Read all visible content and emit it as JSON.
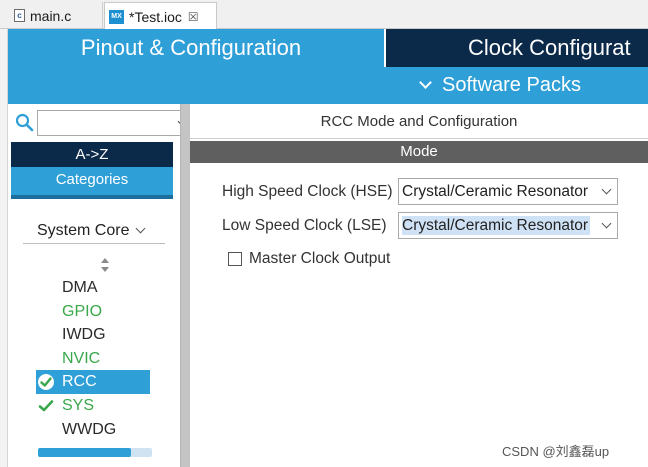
{
  "tabs": [
    {
      "label": "main.c",
      "icon": "c-file-icon"
    },
    {
      "label": "*Test.ioc",
      "icon": "mx-file-icon",
      "close": "☒"
    }
  ],
  "header": {
    "pinout_tab": "Pinout & Configuration",
    "clock_tab": "Clock Configurat",
    "software_packs": "Software Packs"
  },
  "left_panel": {
    "search": {
      "value": "",
      "placeholder": ""
    },
    "az_button": "A->Z",
    "categories_button": "Categories",
    "section": "System Core",
    "items": [
      {
        "label": "DMA",
        "state": "normal",
        "color": "#2a2a2a"
      },
      {
        "label": "GPIO",
        "state": "configured",
        "color": "#3aa84a"
      },
      {
        "label": "IWDG",
        "state": "normal",
        "color": "#2a2a2a"
      },
      {
        "label": "NVIC",
        "state": "configured",
        "color": "#3aa84a"
      },
      {
        "label": "RCC",
        "state": "selected-checked",
        "color": "#ffffff"
      },
      {
        "label": "SYS",
        "state": "checked",
        "color": "#3aa84a"
      },
      {
        "label": "WWDG",
        "state": "normal",
        "color": "#2a2a2a"
      }
    ],
    "scroll_fraction": 0.82
  },
  "right_panel": {
    "title": "RCC Mode and Configuration",
    "mode_header": "Mode",
    "hse": {
      "label": "High Speed Clock (HSE)",
      "value": "Crystal/Ceramic Resonator"
    },
    "lse": {
      "label": "Low Speed Clock (LSE)",
      "value": "Crystal/Ceramic Resonator"
    },
    "master_clock_output": {
      "label": "Master Clock Output",
      "checked": false
    }
  },
  "watermark": "CSDN @刘鑫磊up",
  "colors": {
    "accent_blue": "#2f9fd8",
    "navy": "#0b2a4a",
    "mode_gray": "#5f5f5f",
    "configured_green": "#3aa84a"
  }
}
